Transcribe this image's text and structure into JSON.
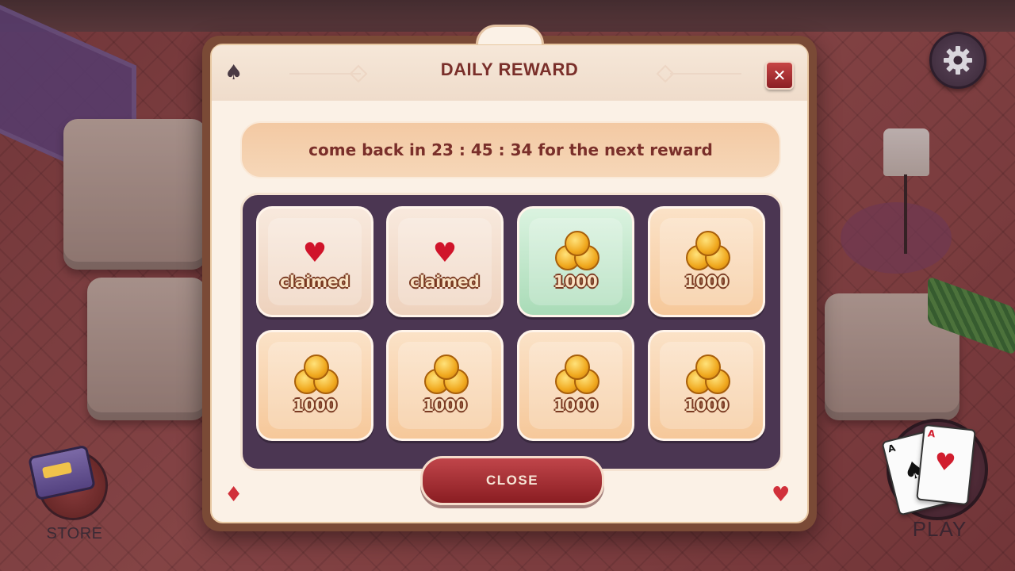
{
  "dialog": {
    "title": "DAILY REWARD",
    "close_x": "✕",
    "timer_text": "come back in 23 : 45 : 34 for the next reward",
    "close_button": "CLOSE"
  },
  "rewards": [
    {
      "state": "claimed",
      "label": "claimed",
      "icon": "heart-icon"
    },
    {
      "state": "claimed",
      "label": "claimed",
      "icon": "heart-icon"
    },
    {
      "state": "current",
      "label": "1000",
      "icon": "coins-icon"
    },
    {
      "state": "locked",
      "label": "1000",
      "icon": "coins-icon"
    },
    {
      "state": "locked",
      "label": "1000",
      "icon": "coins-icon"
    },
    {
      "state": "locked",
      "label": "1000",
      "icon": "coins-icon"
    },
    {
      "state": "locked",
      "label": "1000",
      "icon": "coins-icon"
    },
    {
      "state": "locked",
      "label": "1000",
      "icon": "coins-icon"
    }
  ],
  "hud": {
    "store_label": "STORE",
    "play_label": "PLAY",
    "play_card_front": "A",
    "play_card_back": "A",
    "settings_icon": "gear-icon"
  },
  "colors": {
    "title": "#7a2f2a",
    "grid_bg": "#4b3652",
    "claimed_heart": "#d0142a",
    "current_tile": "#a9dbb7",
    "close_button": "#8a1d22"
  }
}
